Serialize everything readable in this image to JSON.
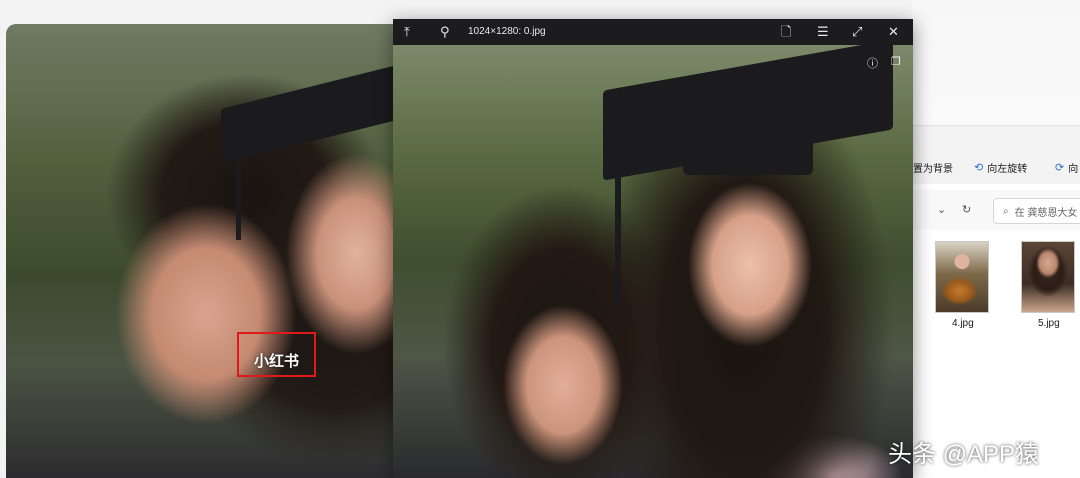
{
  "viewer": {
    "title": "1024×1280: 0.jpg",
    "icons": {
      "back_to_top": "arrow-to-top-icon",
      "pin": "pin-icon",
      "document": "document-icon",
      "list": "list-icon",
      "fullscreen": "expand-icon",
      "close": "close-icon",
      "info": "info-icon",
      "gallery": "gallery-icon"
    }
  },
  "watermark": {
    "label": "小红书",
    "highlight_color": "#e0191b"
  },
  "explorer": {
    "commands": [
      {
        "label": "置为背景"
      },
      {
        "label": "向左旋转",
        "icon": "rotate-left-icon"
      },
      {
        "label": "向",
        "icon": "rotate-right-icon"
      }
    ],
    "search_placeholder": "在 龚慈恩大女",
    "files": [
      {
        "name": "4.jpg"
      },
      {
        "name": "5.jpg"
      }
    ]
  },
  "credit": "头条 @APP猿"
}
